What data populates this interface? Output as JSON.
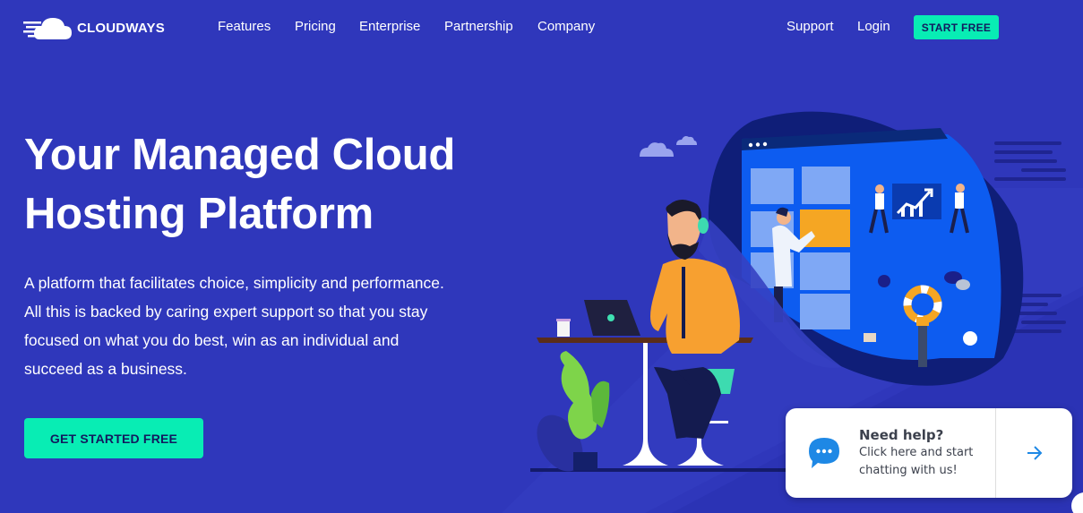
{
  "header": {
    "logo_text": "CLOUDWAYS",
    "nav": [
      {
        "label": "Features"
      },
      {
        "label": "Pricing"
      },
      {
        "label": "Enterprise"
      },
      {
        "label": "Partnership"
      },
      {
        "label": "Company"
      }
    ],
    "support_label": "Support",
    "login_label": "Login",
    "start_free_label": "START FREE"
  },
  "hero": {
    "title_lines": [
      "Your Managed Cloud",
      "Hosting Platform"
    ],
    "description_lines": [
      "A platform that facilitates choice, simplicity and performance.",
      "All this is backed by caring expert support so that you stay",
      "focused on what you do best, win as an individual and",
      "succeed as a business."
    ],
    "cta_label": "GET STARTED FREE"
  },
  "chat_widget": {
    "title": "Need help?",
    "subtitle_lines": [
      "Click here and start",
      "chatting with us!"
    ],
    "icon": "chat-bubble-icon",
    "arrow_icon": "arrow-right-icon"
  },
  "colors": {
    "background": "#2f37bb",
    "accent": "#08edb4",
    "accent_text": "#121a5e",
    "chat_blue": "#1e88e5"
  }
}
